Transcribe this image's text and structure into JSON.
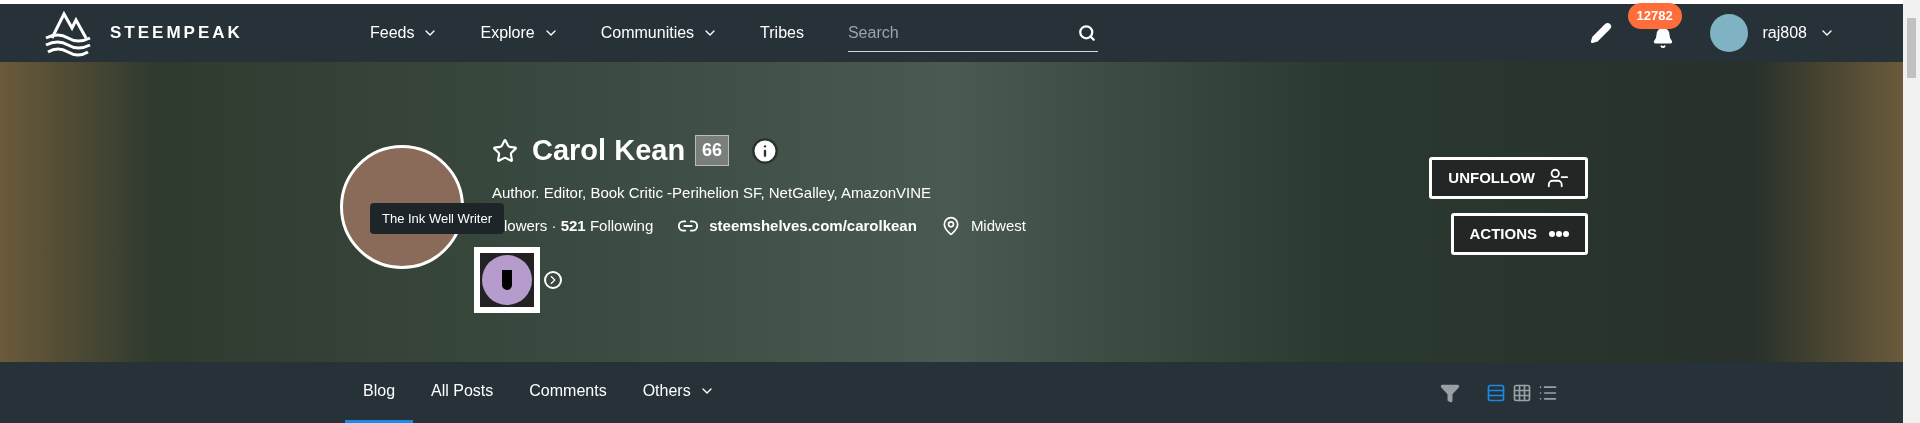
{
  "nav": {
    "logo": "STEEMPEAK",
    "menu": [
      {
        "label": "Feeds",
        "dropdown": true
      },
      {
        "label": "Explore",
        "dropdown": true
      },
      {
        "label": "Communities",
        "dropdown": true
      },
      {
        "label": "Tribes",
        "dropdown": false
      }
    ],
    "search": {
      "placeholder": "Search"
    },
    "notifications": "12782",
    "user": "raj808"
  },
  "profile": {
    "name": "Carol Kean",
    "reputation": "66",
    "starred": false,
    "bio": "Author. Editor, Book Critic -Perihelion SF, NetGalley, AmazonVINE",
    "stats": "lowers · **521** Following",
    "website": "steemshelves.com/carolkean",
    "location": "Midwest",
    "badge_tooltip": "The Ink Well Writer",
    "buttons": [
      {
        "label": "UNFOLLOW",
        "kind": "unfollow"
      },
      {
        "label": "ACTIONS",
        "kind": "actions"
      }
    ]
  },
  "tabs": [
    {
      "label": "Blog",
      "selected": true,
      "dropdown": false
    },
    {
      "label": "All Posts",
      "selected": false,
      "dropdown": false
    },
    {
      "label": "Comments",
      "selected": false,
      "dropdown": false
    },
    {
      "label": "Others",
      "selected": false,
      "dropdown": true
    }
  ],
  "views": [
    {
      "kind": "rows",
      "selected": true
    },
    {
      "kind": "grid",
      "selected": false
    },
    {
      "kind": "list",
      "selected": false
    }
  ]
}
